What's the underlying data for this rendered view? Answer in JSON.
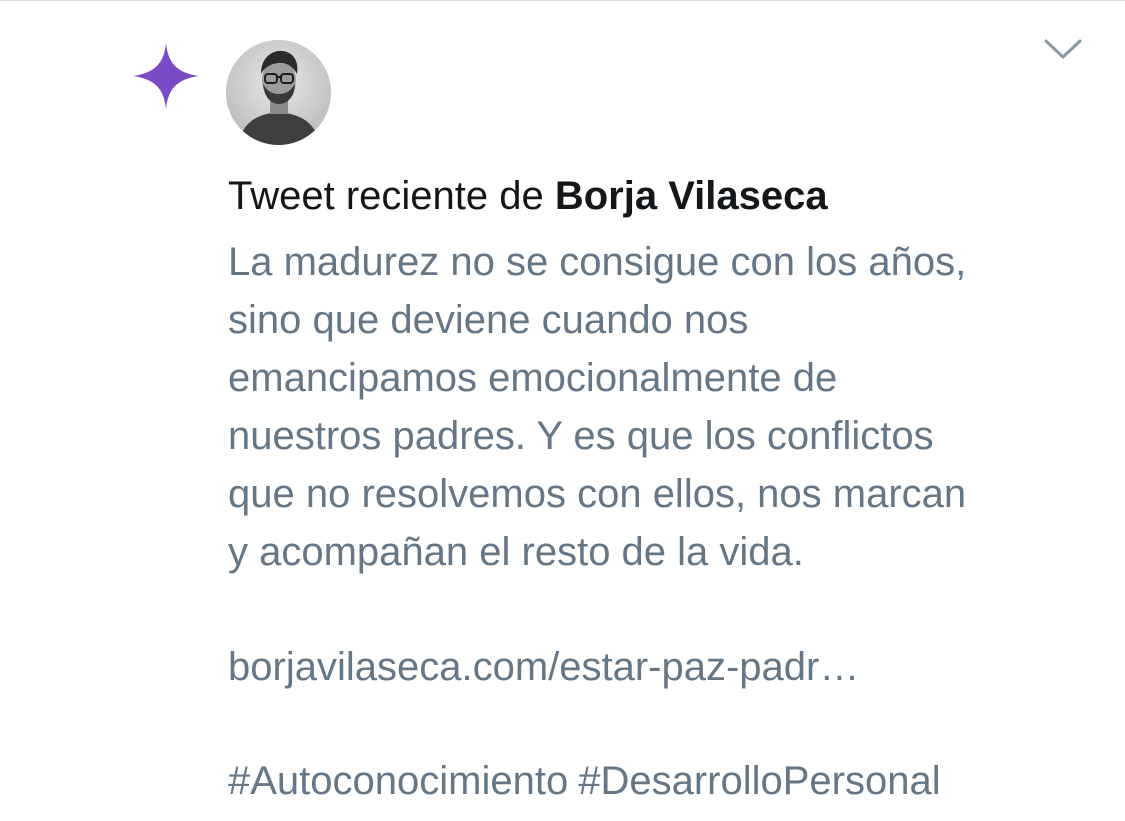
{
  "notification": {
    "type_icon": "sparkle-icon",
    "accent_color": "#794bc4",
    "avatar_icon": "avatar-photo",
    "menu_icon": "chevron-down-icon",
    "heading_prefix": "Tweet reciente de ",
    "author_name": "Borja Vilaseca",
    "tweet": {
      "lines": [
        "La madurez no se consigue con los años,",
        "sino que deviene cuando nos",
        "emancipamos emocionalmente de",
        "nuestros padres. Y es que los conflictos",
        "que no resolvemos con ellos, nos marcan",
        "y acompañan el resto de la vida."
      ],
      "link": "borjavilaseca.com/estar-paz-padr…",
      "hashtags": [
        "#Autoconocimiento",
        "#DesarrolloPersonal"
      ]
    },
    "text_color": "#657786",
    "heading_color": "#14171a"
  }
}
